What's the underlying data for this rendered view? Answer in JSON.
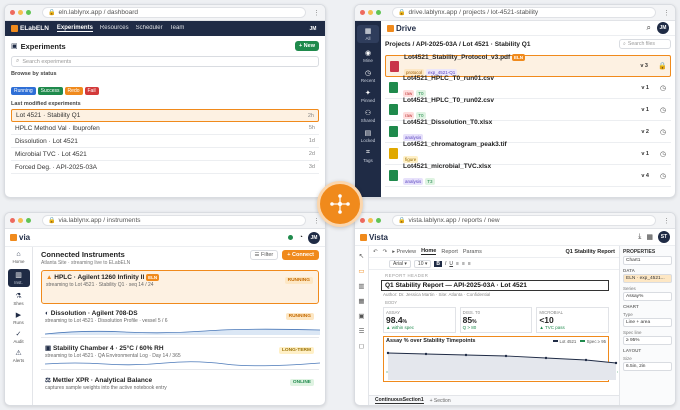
{
  "colors": {
    "accent": "#f08a1c",
    "navy": "#1f2b45",
    "green": "#1f8a4c"
  },
  "eln": {
    "url": "eln.lablynx.app / dashboard",
    "logo": "ELabELN",
    "nav": [
      "Experiments",
      "Resources",
      "Scheduler",
      "Team"
    ],
    "avatar": "JM",
    "title": "Experiments",
    "new_button": "+ New",
    "search_placeholder": "Search experiments",
    "browse_label": "Browse by status",
    "statuses": [
      {
        "label": "Running",
        "color": "#2f6fd6"
      },
      {
        "label": "Success",
        "color": "#1f8a4c"
      },
      {
        "label": "Redo",
        "color": "#f08a1c"
      },
      {
        "label": "Fail",
        "color": "#d33a3a"
      }
    ],
    "recent_label": "Last modified experiments",
    "experiments": [
      {
        "name": "Lot 4521 · Stability Q1",
        "time": "2h"
      },
      {
        "name": "HPLC Method Val · Ibuprofen",
        "time": "5h"
      },
      {
        "name": "Dissolution · Lot 4521",
        "time": "1d"
      },
      {
        "name": "Microbial TVC · Lot 4521",
        "time": "2d"
      },
      {
        "name": "Forced Deg. · API-2025-03A",
        "time": "3d"
      }
    ]
  },
  "drive": {
    "url": "drive.lablynx.app / projects / lot-4521-stability",
    "logo": "Drive",
    "breadcrumb": "Projects / API-2025-03A / Lot 4521 · Stability Q1",
    "search_placeholder": "Search files",
    "avatar": "JM",
    "side": [
      "All",
      "Mine",
      "Recent",
      "Pinned",
      "Shared",
      "Locked",
      "Tags"
    ],
    "files": [
      {
        "name": "Lot4521_Stability_Protocol_v3.pdf",
        "tags": [
          {
            "t": "protocol",
            "c": "tag-proto"
          },
          {
            "t": "exp_4521-Q1",
            "c": "tag-exp"
          }
        ],
        "badge": "ELN",
        "ver": "v 3",
        "icon": "lock-icon",
        "glyph": "🔒",
        "color": "#c9344a"
      },
      {
        "name": "Lot4521_HPLC_T0_run01.csv",
        "tags": [
          {
            "t": "raw",
            "c": "tag-raw"
          },
          {
            "t": "T0",
            "c": "tag-t0"
          }
        ],
        "ver": "v 1",
        "icon": "clock-icon",
        "glyph": "◷",
        "color": "#1f8a4c"
      },
      {
        "name": "Lot4521_HPLC_T0_run02.csv",
        "tags": [
          {
            "t": "raw",
            "c": "tag-raw"
          },
          {
            "t": "T0",
            "c": "tag-t0"
          }
        ],
        "ver": "v 1",
        "icon": "clock-icon",
        "glyph": "◷",
        "color": "#1f8a4c"
      },
      {
        "name": "Lot4521_Dissolution_T0.xlsx",
        "tags": [
          {
            "t": "analysis",
            "c": "tag-analysis"
          }
        ],
        "ver": "v 2",
        "icon": "clock-icon",
        "glyph": "◷",
        "color": "#1f8a4c"
      },
      {
        "name": "Lot4521_chromatogram_peak3.tif",
        "tags": [
          {
            "t": "figure",
            "c": "tag-figure"
          }
        ],
        "ver": "v 1",
        "icon": "clock-icon",
        "glyph": "◷",
        "color": "#e0a800"
      },
      {
        "name": "Lot4521_microbial_TVC.xlsx",
        "tags": [
          {
            "t": "analysis",
            "c": "tag-analysis"
          },
          {
            "t": "T3",
            "c": "tag-t0"
          }
        ],
        "ver": "v 4",
        "icon": "clock-icon",
        "glyph": "◷",
        "color": "#1f8a4c"
      }
    ]
  },
  "instruments": {
    "url": "via.lablynx.app / instruments",
    "logo": "via",
    "title": "Connected Instruments",
    "subtitle": "Atlanta Site · streaming live to ELabELN",
    "filter": "Filter",
    "connect": "+ Connect",
    "avatar": "JM",
    "side": [
      "Home",
      "Inst.",
      "Shes",
      "Runs",
      "Audit",
      "Alerts"
    ],
    "items": [
      {
        "name": "HPLC · Agilent 1260 Infinity II",
        "badge": "ELN",
        "sub": "streaming to Lot 4521 · Stability Q1 · seq 14 / 24",
        "status": "RUNNING"
      },
      {
        "name": "Dissolution · Agilent 708-DS",
        "sub": "streaming to Lot 4521 · Dissolution Profile · vessel 5 / 6",
        "status": "RUNNING"
      },
      {
        "name": "Stability Chamber 4 · 25°C / 60% RH",
        "sub": "streaming to Lot 4521 · QA Environmental Log · Day 14 / 365",
        "status": "LONG-TERM"
      },
      {
        "name": "Mettler XPR · Analytical Balance",
        "sub": "captures sample weights into the active notebook entry",
        "status": "ONLINE"
      }
    ]
  },
  "vista": {
    "url": "vista.lablynx.app / reports / new",
    "logo": "Vista",
    "avatar": "ST",
    "tabs": [
      "Preview",
      "Home",
      "Report",
      "Params"
    ],
    "doc_title": "Q1 Stability Report",
    "font": "Arial",
    "font_size": "10",
    "section_header": "REPORT HEADER",
    "report_title": "Q1 Stability Report — API-2025-03A · Lot 4521",
    "report_author": "Author: Dr. Jessica Martin · Site: Atlanta · Confidential",
    "body_label": "BODY",
    "metrics": [
      {
        "label": "ASSAY",
        "value": "98.4",
        "unit": "%",
        "note": "▲ within spec"
      },
      {
        "label": "DISS. T0",
        "value": "85",
        "unit": "%",
        "note": "Q > 80"
      },
      {
        "label": "MICROBIAL",
        "value": "<10",
        "unit": "",
        "note": "▲ TVC pass"
      }
    ],
    "chart_title": "Assay % over Stability Timepoints",
    "legend": [
      "Lot 4521",
      "Spec ≥ 95"
    ],
    "section_tab": "ContinuousSection1",
    "add_section": "+ Section",
    "props": {
      "title": "PROPERTIES",
      "element": "Chart1",
      "data_label": "DATA",
      "data_val": "ELN · exp_4521...",
      "series_label": "Series",
      "series_val": "Assay%",
      "chart_label": "CHART",
      "type_label": "Type",
      "type_val": "Line + area",
      "spec_label": "Spec line",
      "spec_val": "≥ 95%",
      "layout_label": "LAYOUT",
      "size_label": "Size",
      "size_val": "6.5in, 2in"
    }
  }
}
